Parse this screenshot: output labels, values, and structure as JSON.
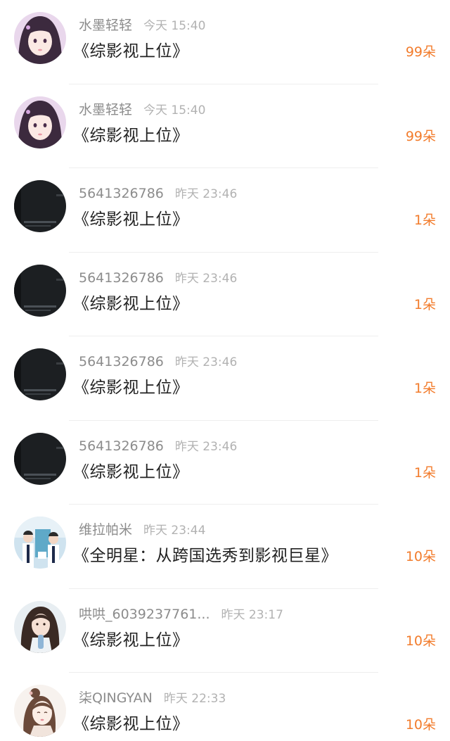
{
  "items": [
    {
      "username": "水墨轻轻",
      "time": "今天 15:40",
      "title": "《综影视上位》",
      "count": "99朵",
      "avatar": "girl-anime-avatar"
    },
    {
      "username": "水墨轻轻",
      "time": "今天 15:40",
      "title": "《综影视上位》",
      "count": "99朵",
      "avatar": "girl-anime-avatar"
    },
    {
      "username": "5641326786",
      "time": "昨天 23:46",
      "title": "《综影视上位》",
      "count": "1朵",
      "avatar": "dark-screenshot-avatar"
    },
    {
      "username": "5641326786",
      "time": "昨天 23:46",
      "title": "《综影视上位》",
      "count": "1朵",
      "avatar": "dark-screenshot-avatar"
    },
    {
      "username": "5641326786",
      "time": "昨天 23:46",
      "title": "《综影视上位》",
      "count": "1朵",
      "avatar": "dark-screenshot-avatar"
    },
    {
      "username": "5641326786",
      "time": "昨天 23:46",
      "title": "《综影视上位》",
      "count": "1朵",
      "avatar": "dark-screenshot-avatar"
    },
    {
      "username": "维拉帕米",
      "time": "昨天 23:44",
      "title": "《全明星：从跨国选秀到影视巨星》",
      "count": "10朵",
      "avatar": "group-photo-avatar"
    },
    {
      "username": "哄哄_6039237761...",
      "time": "昨天 23:17",
      "title": "《综影视上位》",
      "count": "10朵",
      "avatar": "girl-photo-avatar"
    },
    {
      "username": "柒QINGYAN",
      "time": "昨天 22:33",
      "title": "《综影视上位》",
      "count": "10朵",
      "avatar": "illustrated-girl-avatar"
    }
  ],
  "colors": {
    "accent": "#f27c2c",
    "username": "#8c8c8c",
    "time": "#b2b2b2",
    "title": "#222222",
    "divider": "#eeeeee"
  }
}
